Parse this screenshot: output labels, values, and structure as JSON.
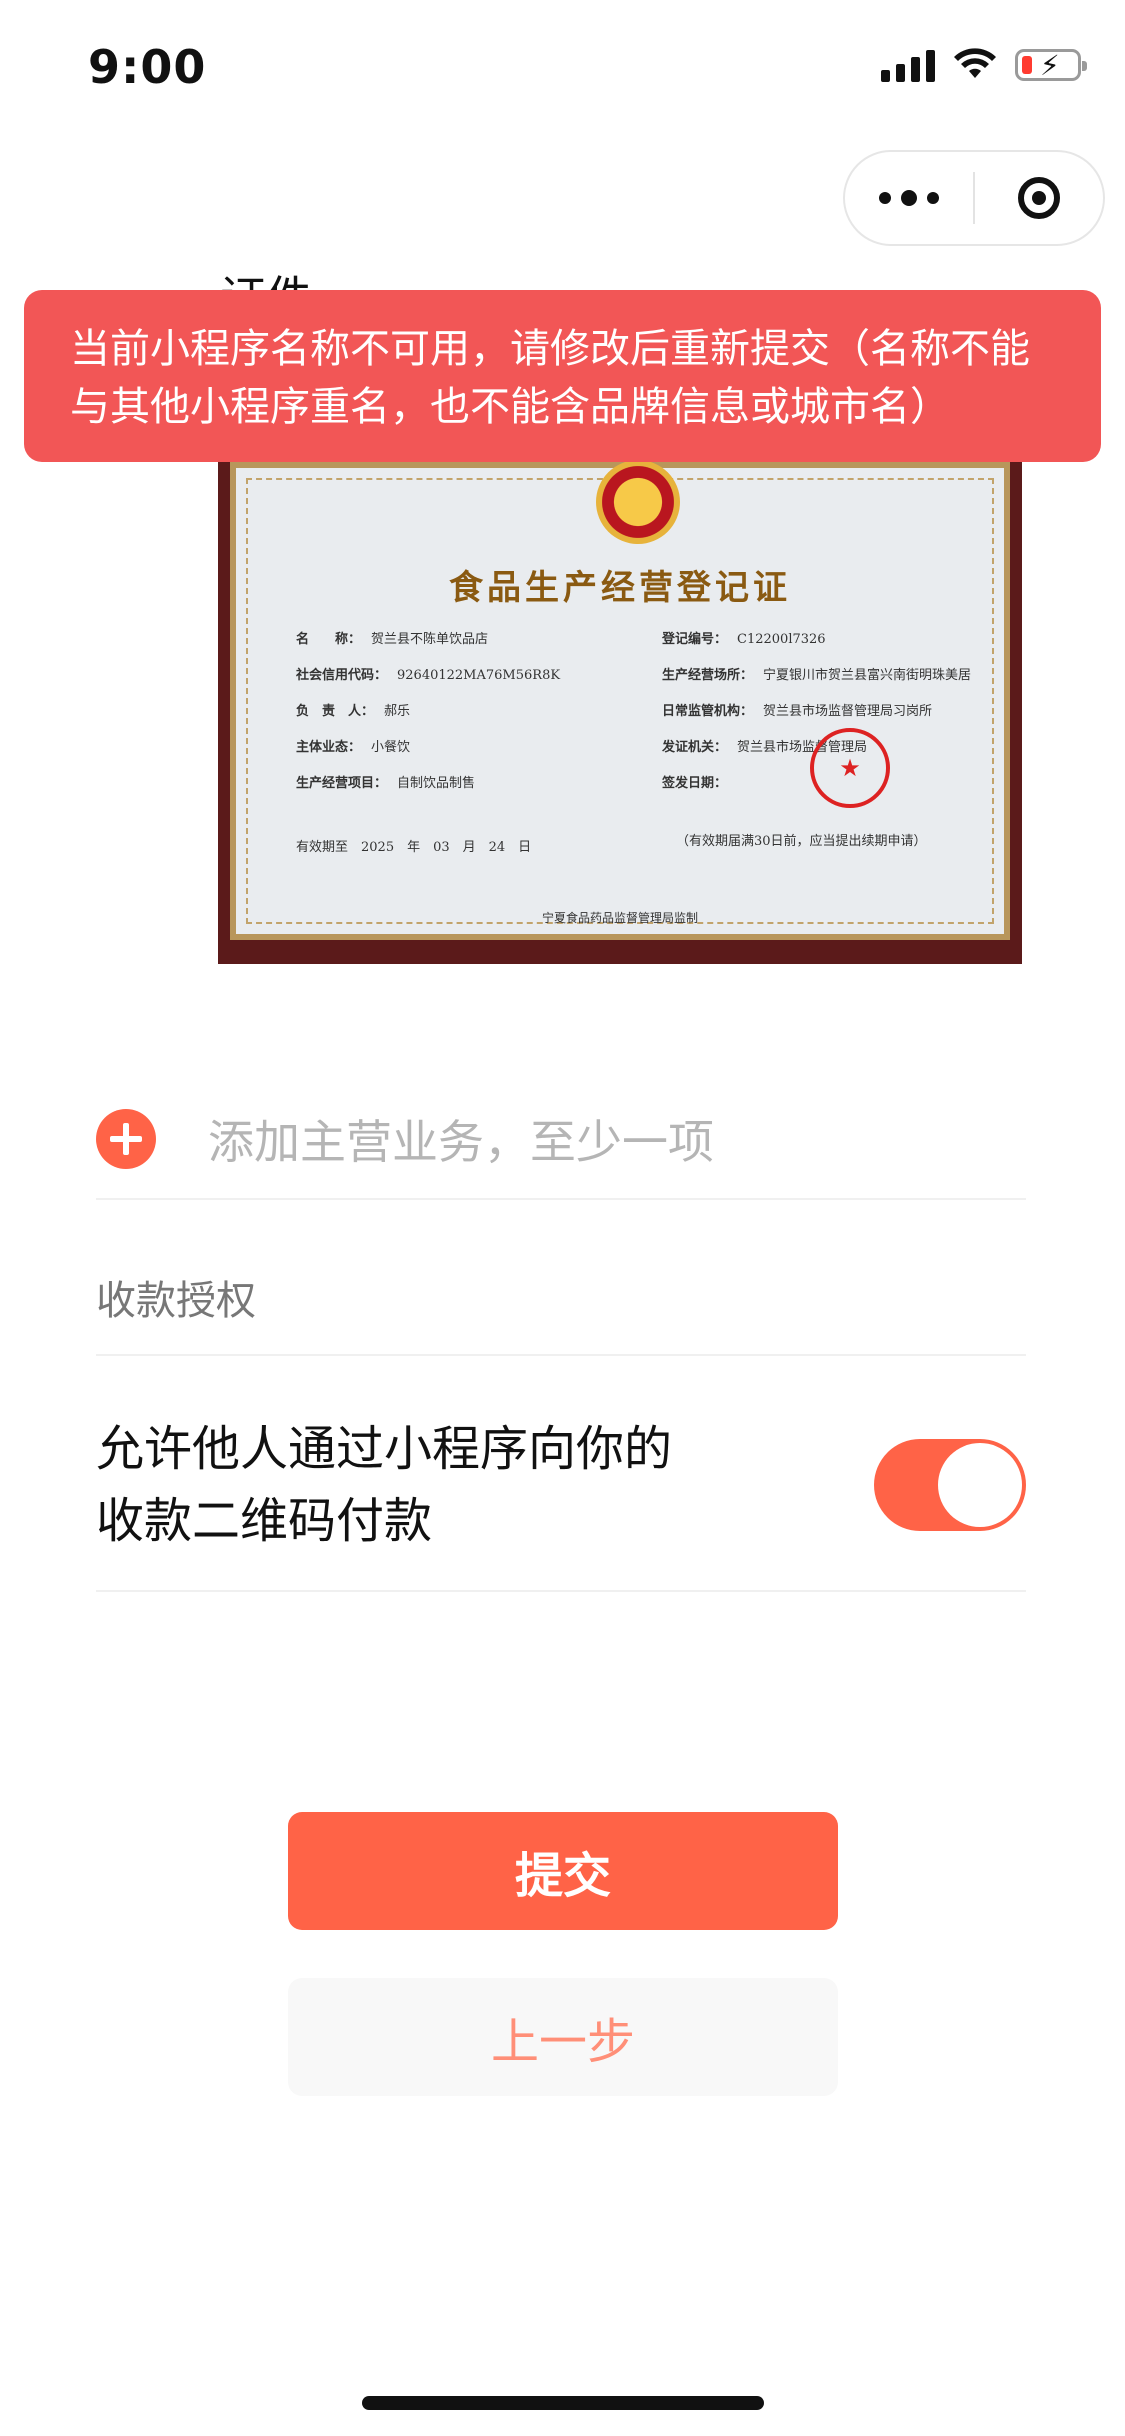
{
  "status_bar": {
    "time": "9:00"
  },
  "capsule": {
    "more_icon": "more-dots-icon",
    "close_icon": "target-circle-icon"
  },
  "background_label": "证件",
  "toast": {
    "message": "当前小程序名称不可用，请修改后重新提交（名称不能与其他小程序重名，也不能含品牌信息或城市名）"
  },
  "certificate": {
    "title": "食品生产经营登记证",
    "fields": [
      {
        "k": "名　　称：",
        "v": "贺兰县不陈单饮品店"
      },
      {
        "k": "社会信用代码：",
        "v": "92640122MA76M56R8K"
      },
      {
        "k": "负　责　人：",
        "v": "郝乐"
      },
      {
        "k": "主体业态：",
        "v": "小餐饮"
      },
      {
        "k": "生产经营项目：",
        "v": "自制饮品制售"
      }
    ],
    "fields_right": [
      {
        "k": "登记编号：",
        "v": "C12200l7326"
      },
      {
        "k": "生产经营场所：",
        "v": "宁夏银川市贺兰县富兴南街明珠美居"
      },
      {
        "k": "日常监管机构：",
        "v": "贺兰县市场监督管理局习岗所"
      },
      {
        "k": "发证机关：",
        "v": "贺兰县市场监督管理局"
      },
      {
        "k": "签发日期：",
        "v": ""
      }
    ],
    "validity": "有效期至　2025　年　03　月　24　日",
    "note": "（有效期届满30日前，应当提出续期申请）",
    "issuer_footer": "宁夏食品药品监督管理局监制"
  },
  "add_business": {
    "placeholder": "添加主营业务，至少一项"
  },
  "payment_auth": {
    "section_title": "收款授权",
    "description": "允许他人通过小程序向你的收款二维码付款",
    "toggle_on": true
  },
  "buttons": {
    "submit": "提交",
    "previous": "上一步"
  },
  "colors": {
    "accent": "#ff6347",
    "toast_bg": "#f25656"
  }
}
